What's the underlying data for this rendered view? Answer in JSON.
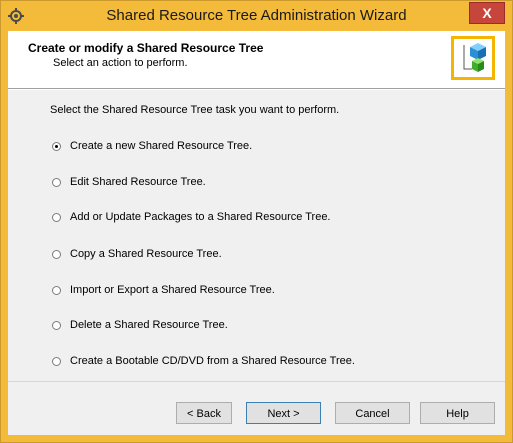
{
  "window": {
    "title": "Shared Resource Tree Administration Wizard",
    "close_label": "X"
  },
  "header": {
    "title": "Create or modify a Shared Resource Tree",
    "subtitle": "Select an action to perform."
  },
  "main": {
    "prompt": "Select the Shared Resource Tree task you want to perform.",
    "options": [
      {
        "label": "Create a new Shared Resource Tree.",
        "selected": true
      },
      {
        "label": "Edit Shared Resource Tree.",
        "selected": false
      },
      {
        "label": "Add or Update Packages to a Shared Resource Tree.",
        "selected": false
      },
      {
        "label": "Copy a Shared Resource Tree.",
        "selected": false
      },
      {
        "label": "Import or Export a Shared Resource Tree.",
        "selected": false
      },
      {
        "label": "Delete a Shared Resource Tree.",
        "selected": false
      },
      {
        "label": "Create a Bootable CD/DVD from a Shared Resource Tree.",
        "selected": false
      }
    ]
  },
  "buttons": {
    "back": "< Back",
    "next": "Next >",
    "cancel": "Cancel",
    "help": "Help"
  }
}
